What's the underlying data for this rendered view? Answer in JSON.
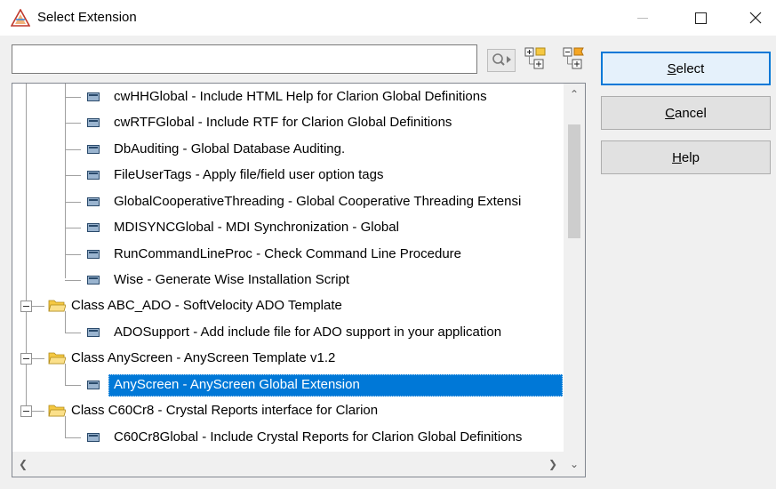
{
  "window": {
    "title": "Select Extension",
    "minimize_icon": "minimize-icon",
    "maximize_icon": "maximize-icon",
    "close_icon": "close-icon"
  },
  "search": {
    "value": "",
    "placeholder": ""
  },
  "toolbar": {
    "icons": [
      "find-icon",
      "expand-all-icon",
      "collapse-all-icon"
    ]
  },
  "tree": {
    "items": [
      {
        "label": "cwHHGlobal - Include HTML Help for Clarion Global Definitions",
        "type": "extension"
      },
      {
        "label": "cwRTFGlobal - Include RTF for Clarion Global Definitions",
        "type": "extension"
      },
      {
        "label": "DbAuditing - Global Database Auditing.",
        "type": "extension"
      },
      {
        "label": "FileUserTags - Apply file/field user option tags",
        "type": "extension"
      },
      {
        "label": "GlobalCooperativeThreading - Global Cooperative Threading Extensi",
        "type": "extension"
      },
      {
        "label": "MDISYNCGlobal - MDI Synchronization - Global",
        "type": "extension"
      },
      {
        "label": "RunCommandLineProc - Check Command Line Procedure",
        "type": "extension"
      },
      {
        "label": "Wise - Generate Wise Installation Script",
        "type": "extension"
      },
      {
        "label": "Class ABC_ADO - SoftVelocity ADO Template",
        "type": "class",
        "expanded": true
      },
      {
        "label": "ADOSupport - Add include file for ADO support in your application",
        "type": "extension"
      },
      {
        "label": "Class AnyScreen - AnyScreen Template v1.2",
        "type": "class",
        "expanded": true
      },
      {
        "label": "AnyScreen - AnyScreen Global Extension",
        "type": "extension",
        "selected": true
      },
      {
        "label": "Class C60Cr8 - Crystal Reports interface for Clarion",
        "type": "class",
        "expanded": true
      },
      {
        "label": "C60Cr8Global - Include Crystal Reports for Clarion Global Definitions",
        "type": "extension"
      }
    ],
    "selected_color": "#0078d7"
  },
  "buttons": {
    "select": {
      "mnemonic": "S",
      "rest": "elect"
    },
    "cancel": {
      "mnemonic": "C",
      "rest": "ancel"
    },
    "help": {
      "mnemonic": "H",
      "rest": "elp"
    }
  },
  "colors": {
    "accent": "#0078d7",
    "folder": "#f5c842"
  }
}
